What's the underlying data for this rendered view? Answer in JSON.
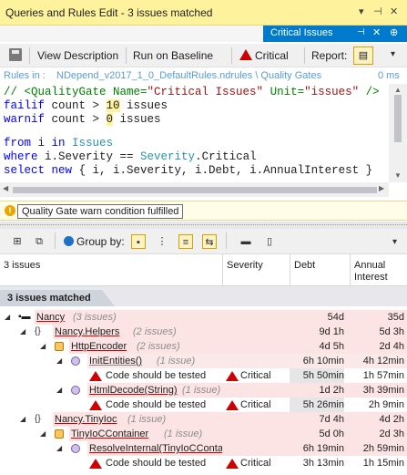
{
  "window": {
    "title": "Queries and Rules Edit  -  3 issues matched"
  },
  "tab": {
    "label": "Critical Issues"
  },
  "toolbar": {
    "view_description": "View Description",
    "run_on_baseline": "Run on Baseline",
    "critical": "Critical",
    "report": "Report:"
  },
  "rules_in": {
    "prefix": "Rules in :",
    "path": "NDepend_v2017_1_0_DefaultRules.ndrules \\ Quality Gates",
    "time": "0 ms"
  },
  "code": {
    "l1_comment_a": "// <QualityGate Name=",
    "l1_str_a": "\"Critical Issues\"",
    "l1_comment_b": " Unit=",
    "l1_str_b": "\"issues\"",
    "l1_comment_c": " />",
    "l2_kw": "failif",
    "l2_mid": " count > ",
    "l2_num": "10",
    "l2_end": " issues",
    "l3_kw": "warnif",
    "l3_mid": " count > ",
    "l3_num": "0",
    "l3_end": " issues",
    "l5_kw1": "from",
    "l5_mid": " i ",
    "l5_kw2": "in",
    "l5_ty": " Issues",
    "l6_kw": "where",
    "l6_mid": " i.Severity == ",
    "l6_ty": "Severity",
    "l6_end": ".Critical",
    "l7_kw1": "select",
    "l7_kw2": " new",
    "l7_end": " { i, i.Severity, i.Debt, i.AnnualInterest }"
  },
  "warning": {
    "text": "Quality Gate warn condition fulfilled"
  },
  "results_toolbar": {
    "group_by": "Group by:"
  },
  "columns": {
    "c1": "3 issues",
    "c2": "Severity",
    "c3": "Debt",
    "c4": "Annual Interest"
  },
  "group_tab": "3 issues matched",
  "rows": [
    {
      "name": "Nancy",
      "count": "(3 issues)",
      "debt": "54d",
      "ai": "35d"
    },
    {
      "name": "Nancy.Helpers",
      "count": "(2 issues)",
      "debt": "9d 1h",
      "ai": "5d 3h"
    },
    {
      "name": "HttpEncoder",
      "count": "(2 issues)",
      "debt": "4d 5h",
      "ai": "2d 4h"
    },
    {
      "name": "InitEntities()",
      "count": "(1 issue)",
      "debt": "6h 10min",
      "ai": "4h 12min"
    },
    {
      "name": "Code should be tested",
      "severity": "Critical",
      "debt": "5h 50min",
      "ai": "1h 57min"
    },
    {
      "name": "HtmlDecode(String)",
      "count": "(1 issue)",
      "debt": "1d 2h",
      "ai": "3h 39min"
    },
    {
      "name": "Code should be tested",
      "severity": "Critical",
      "debt": "5h 26min",
      "ai": "2h 9min"
    },
    {
      "name": "Nancy.TinyIoc",
      "count": "(1 issue)",
      "debt": "7d 4h",
      "ai": "4d 2h"
    },
    {
      "name": "TinyIoCContainer",
      "count": "(1 issue)",
      "debt": "5d 0h",
      "ai": "2d 3h"
    },
    {
      "name": "ResolveInternal(TinyIoCConta",
      "count": "",
      "debt": "6h 19min",
      "ai": "2h 59min"
    },
    {
      "name": "Code should be tested",
      "severity": "Critical",
      "debt": "3h 13min",
      "ai": "1h 15min"
    }
  ]
}
